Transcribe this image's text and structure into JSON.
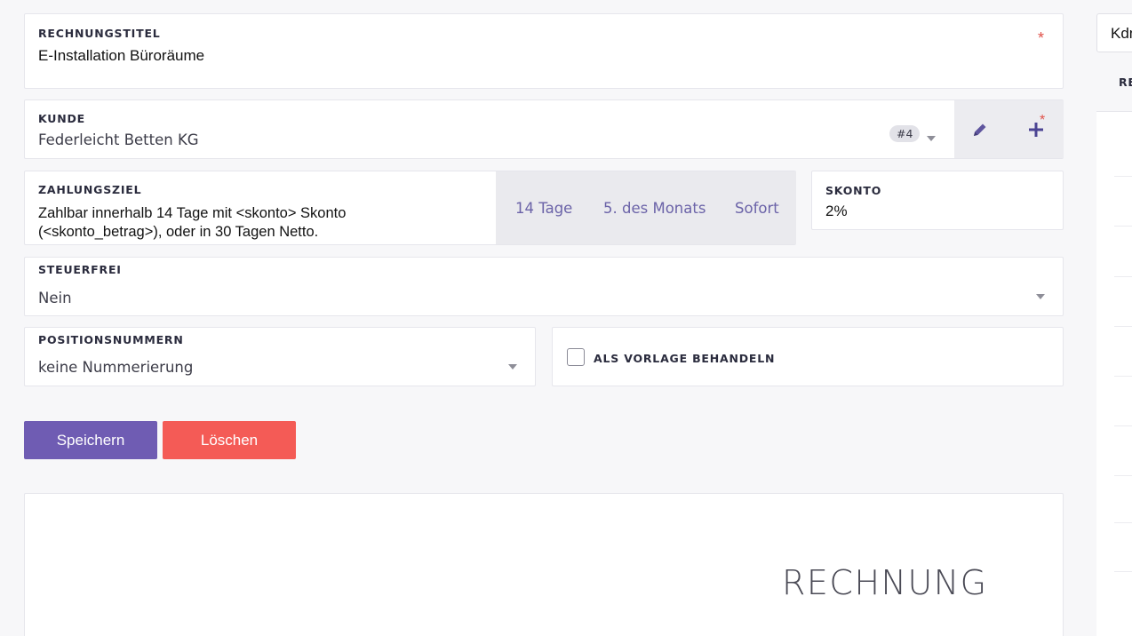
{
  "form": {
    "title_field": {
      "label": "RECHNUNGSTITEL",
      "value": "E-Installation Büroräume",
      "required_mark": "*"
    },
    "customer_field": {
      "label": "KUNDE",
      "value": "Federleicht Betten KG",
      "badge": "#4",
      "add_required_mark": "*"
    },
    "payment_terms": {
      "label": "ZAHLUNGSZIEL",
      "value_line1": "Zahlbar innerhalb 14 Tage mit <skonto> Skonto",
      "value_line2": "(<skonto_betrag>), oder in 30 Tagen Netto.",
      "presets": [
        "14 Tage",
        "5. des Monats",
        "Sofort"
      ]
    },
    "discount_field": {
      "label": "SKONTO",
      "value": "2%"
    },
    "tax_free_field": {
      "label": "STEUERFREI",
      "value": "Nein"
    },
    "position_numbers_field": {
      "label": "POSITIONSNUMMERN",
      "value": "keine Nummerierung"
    },
    "template_checkbox": {
      "label": "ALS VORLAGE BEHANDELN",
      "checked": false
    }
  },
  "actions": {
    "save_label": "Speichern",
    "delete_label": "Löschen"
  },
  "preview": {
    "heading": "RECHNUNG"
  },
  "right_panel": {
    "input_value": "Kdn",
    "heading": "RE"
  },
  "colors": {
    "accent": "#6f5cb3",
    "danger": "#f45b56",
    "required": "#e0524a",
    "link": "#6b63a8"
  }
}
